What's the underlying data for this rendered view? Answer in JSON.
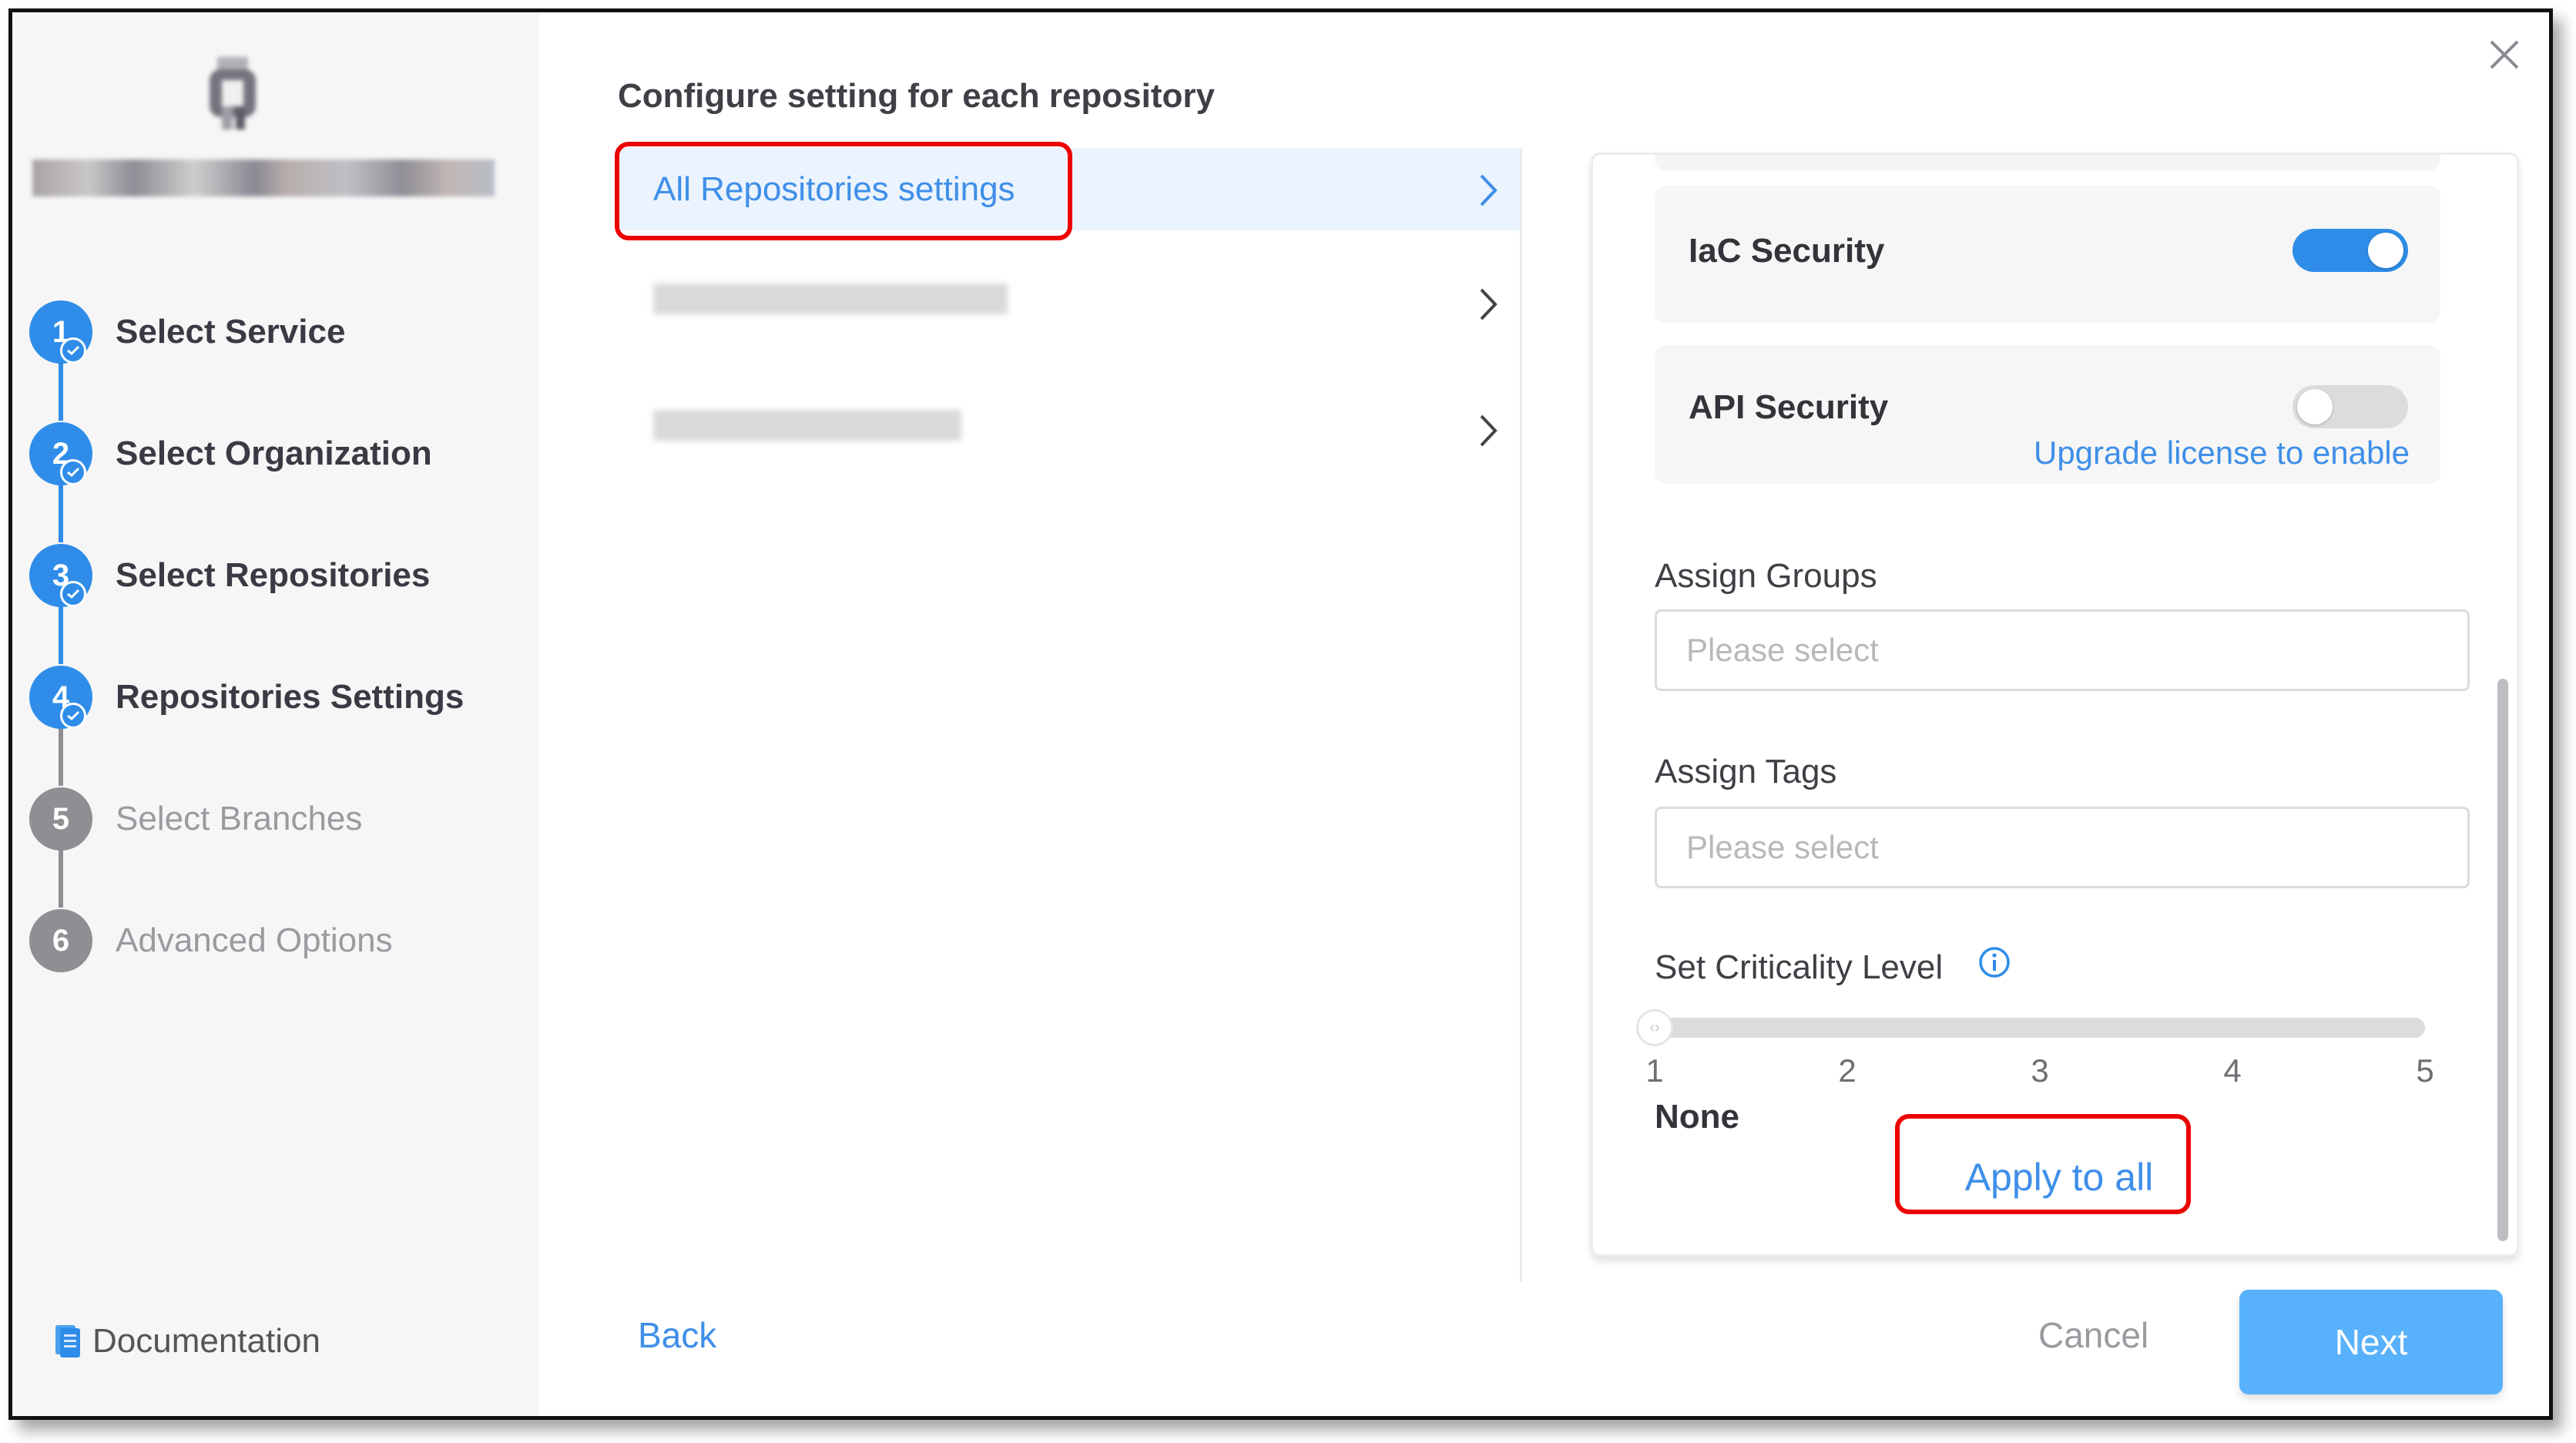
{
  "sidebar": {
    "app_title": "GitHub Import",
    "app_title_redacted": true,
    "logo_icon": "github-icon",
    "steps": [
      {
        "number": "1",
        "label": "Select Service",
        "status": "completed"
      },
      {
        "number": "2",
        "label": "Select Organization",
        "status": "completed"
      },
      {
        "number": "3",
        "label": "Select Repositories",
        "status": "completed"
      },
      {
        "number": "4",
        "label": "Repositories Settings",
        "status": "current"
      },
      {
        "number": "5",
        "label": "Select Branches",
        "status": "pending"
      },
      {
        "number": "6",
        "label": "Advanced Options",
        "status": "pending"
      }
    ],
    "documentation_label": "Documentation",
    "documentation_icon": "document-icon"
  },
  "main": {
    "title": "Configure setting for each repository",
    "repositories": [
      {
        "label": "All Repositories settings",
        "selected": true,
        "redacted": false
      },
      {
        "label": "",
        "selected": false,
        "redacted": true
      },
      {
        "label": "",
        "selected": false,
        "redacted": true
      }
    ]
  },
  "settings_panel": {
    "iac_security": {
      "label": "IaC Security",
      "enabled": true
    },
    "api_security": {
      "label": "API Security",
      "enabled": false,
      "upgrade_link": "Upgrade license to enable"
    },
    "assign_groups": {
      "label": "Assign Groups",
      "placeholder": "Please select",
      "value": ""
    },
    "assign_tags": {
      "label": "Assign Tags",
      "placeholder": "Please select",
      "value": ""
    },
    "criticality": {
      "label": "Set Criticality Level",
      "info_icon": "info-icon",
      "ticks": [
        "1",
        "2",
        "3",
        "4",
        "5"
      ],
      "min": 1,
      "max": 5,
      "value": 1,
      "value_label": "None"
    },
    "apply_to_all_label": "Apply to all"
  },
  "footer": {
    "back_label": "Back",
    "cancel_label": "Cancel",
    "next_label": "Next"
  },
  "colors": {
    "accent": "#2f8de9",
    "link": "#3e8fe8",
    "next_button": "#58b1fb",
    "annotation_highlight": "#ee0000",
    "pending_step": "#8e8e93"
  }
}
